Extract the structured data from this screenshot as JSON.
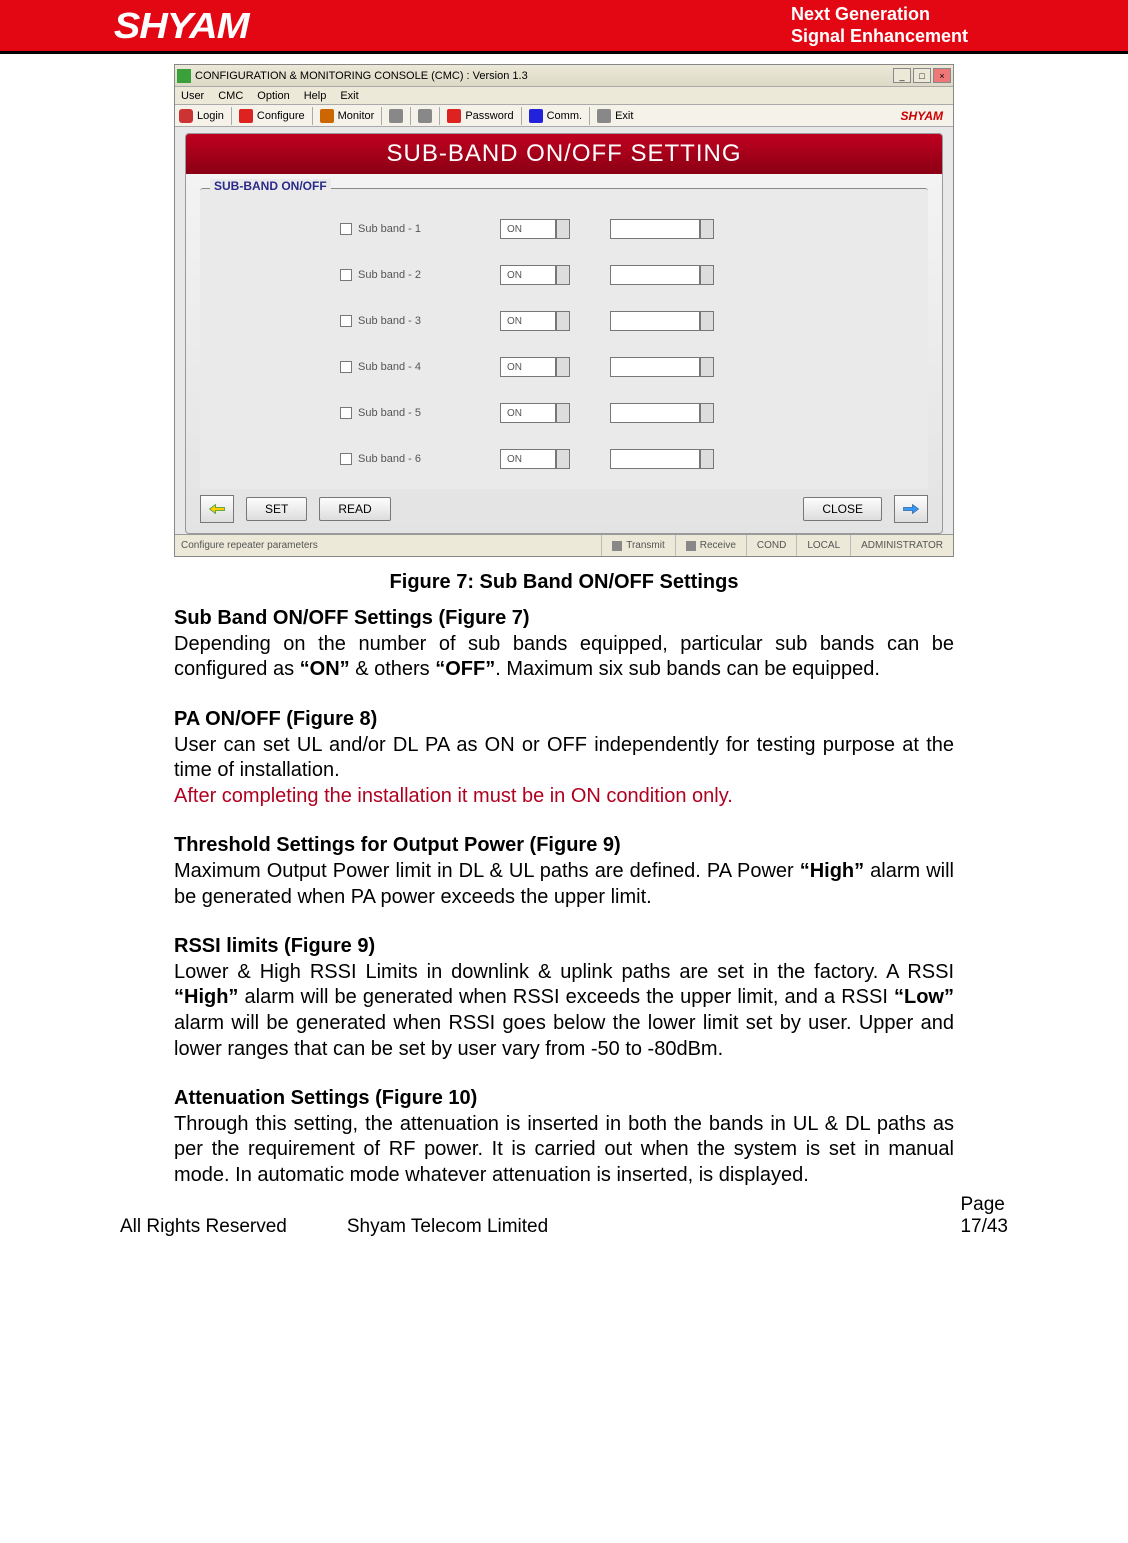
{
  "header": {
    "logo": "SHYAM",
    "tagline1": "Next Generation",
    "tagline2": "Signal Enhancement"
  },
  "screenshot": {
    "title": "CONFIGURATION & MONITORING CONSOLE (CMC)  :  Version 1.3",
    "menu": [
      "User",
      "CMC",
      "Option",
      "Help",
      "Exit"
    ],
    "toolbar": {
      "login": "Login",
      "configure": "Configure",
      "monitor": "Monitor",
      "password": "Password",
      "comm": "Comm.",
      "exit": "Exit",
      "brand": "SHYAM"
    },
    "panel_title": "SUB-BAND ON/OFF SETTING",
    "group_legend": "SUB-BAND ON/OFF",
    "rows": [
      {
        "label": "Sub band - 1",
        "value": "ON"
      },
      {
        "label": "Sub band - 2",
        "value": "ON"
      },
      {
        "label": "Sub band - 3",
        "value": "ON"
      },
      {
        "label": "Sub band - 4",
        "value": "ON"
      },
      {
        "label": "Sub band - 5",
        "value": "ON"
      },
      {
        "label": "Sub band - 6",
        "value": "ON"
      }
    ],
    "buttons": {
      "set": "SET",
      "read": "READ",
      "close": "CLOSE"
    },
    "status": {
      "msg": "Configure repeater parameters",
      "tx": "Transmit",
      "rx": "Receive",
      "cond": "COND",
      "local": "LOCAL",
      "role": "ADMINISTRATOR"
    }
  },
  "caption": "Figure 7: Sub Band ON/OFF Settings",
  "sections": {
    "s1_h": "Sub Band ON/OFF Settings (Figure 7)",
    "s1_a": "Depending on the number of sub bands equipped, particular sub bands can be configured as ",
    "s1_on": "“ON”",
    "s1_b": " & others ",
    "s1_off": "“OFF”",
    "s1_c": ". Maximum six sub bands can be equipped.",
    "s2_h": "PA ON/OFF (Figure 8)",
    "s2_a": "User can set UL and/or DL PA as ON or OFF independently for testing purpose at the time of installation.",
    "s2_note": "After completing the installation it must be in ON condition only.",
    "s3_h": "Threshold Settings for Output Power (Figure 9)",
    "s3_a": "Maximum Output Power limit in DL & UL paths are defined. PA Power ",
    "s3_high": "“High”",
    "s3_b": " alarm will be generated when PA power exceeds the upper limit.",
    "s4_h": "RSSI limits (Figure 9)",
    "s4_a": "Lower & High RSSI Limits in downlink & uplink paths are set in the factory. A RSSI ",
    "s4_high": "“High”",
    "s4_b": " alarm will be generated when RSSI exceeds the upper limit, and a RSSI ",
    "s4_low": "“Low”",
    "s4_c": " alarm will be generated when RSSI goes below the lower limit set by user. Upper and lower ranges that can be set by user vary from -50 to -80dBm.",
    "s5_h": "Attenuation Settings (Figure 10)",
    "s5_a": "Through this setting, the attenuation is inserted in both the bands in UL & DL paths as per the requirement of RF power. It is carried out when the system is set in manual mode. In automatic mode whatever attenuation is inserted, is displayed."
  },
  "footer": {
    "left": "All Rights Reserved",
    "mid": "Shyam Telecom Limited",
    "page_label": "Page",
    "page_num": "17/43"
  }
}
